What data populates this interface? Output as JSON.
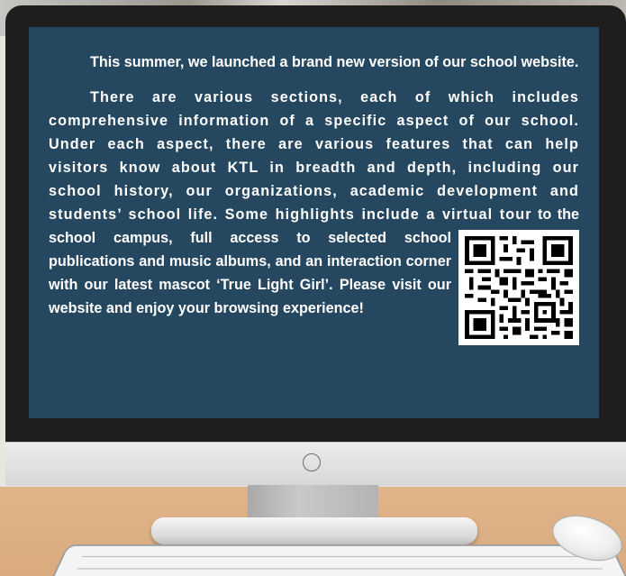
{
  "screen": {
    "paragraph1": "This summer, we launched a brand new version of our school website.",
    "paragraph2_part1": "There are various sections, each of which includes comprehensive information of a specific aspect of our school. Under each aspect, there are various features that can help visitors know about KTL in breadth and depth, including our school history, our organizations, academic development and students’ school life. Some highlights include a virtual tour",
    "paragraph2_part2": "to the school campus, full access to selected school publications and music albums, and an interaction corner with our latest mascot ‘True Light Girl’. Please visit our website and enjoy your browsing experience!",
    "qr_code": "qr-code-icon"
  },
  "colors": {
    "screen_background": "#25475f",
    "text": "#ffffff",
    "monitor_frame": "#1e1e1e",
    "desk": "#dcae82"
  }
}
